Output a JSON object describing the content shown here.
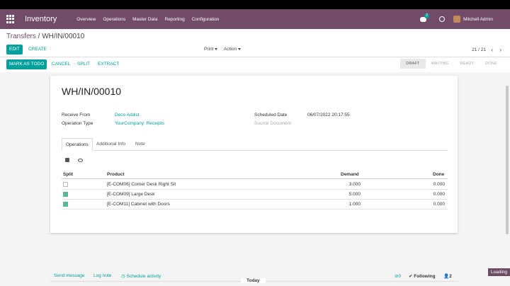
{
  "navbar": {
    "app_name": "Inventory",
    "menu": [
      "Overview",
      "Operations",
      "Master Data",
      "Reporting",
      "Configuration"
    ],
    "chat_badge": "2",
    "user_name": "Mitchell Admin"
  },
  "breadcrumb": {
    "parent": "Transfers",
    "separator": "/",
    "current": "WH/IN/00010"
  },
  "control_panel": {
    "edit": "EDIT",
    "create": "CREATE",
    "print": "Print",
    "action": "Action",
    "pager": "21 / 21"
  },
  "status_bar": {
    "buttons": [
      "MARK AS TODO",
      "CANCEL",
      "SPLIT",
      "EXTRACT"
    ],
    "stages": [
      "DRAFT",
      "WAITING",
      "READY",
      "DONE"
    ],
    "active_stage": "DRAFT"
  },
  "form": {
    "title": "WH/IN/00010",
    "receive_from_label": "Receive From",
    "receive_from_value": "Deco Addict",
    "operation_type_label": "Operation Type",
    "operation_type_value": "YourCompany: Receipts",
    "scheduled_date_label": "Scheduled Date",
    "scheduled_date_value": "06/07/2022 20:17:55",
    "source_document_label": "Source Document"
  },
  "tabs": [
    "Operations",
    "Additional Info",
    "Note"
  ],
  "table": {
    "headers": [
      "Split",
      "Product",
      "Demand",
      "Done"
    ],
    "rows": [
      {
        "product": "[E-COM06] Corner Desk Right Sit",
        "demand": "3.000",
        "done": "0.000",
        "checked": false
      },
      {
        "product": "[E-COM09] Large Desk",
        "demand": "5.000",
        "done": "0.000",
        "checked": true
      },
      {
        "product": "[E-COM11] Cabinet with Doors",
        "demand": "1.000",
        "done": "0.000",
        "checked": true
      }
    ]
  },
  "chatter": {
    "send_message": "Send message",
    "log_note": "Log note",
    "schedule_activity": "Schedule activity",
    "attachments": "0",
    "following": "Following",
    "followers": "2",
    "today": "Today"
  },
  "loading": "Loading"
}
